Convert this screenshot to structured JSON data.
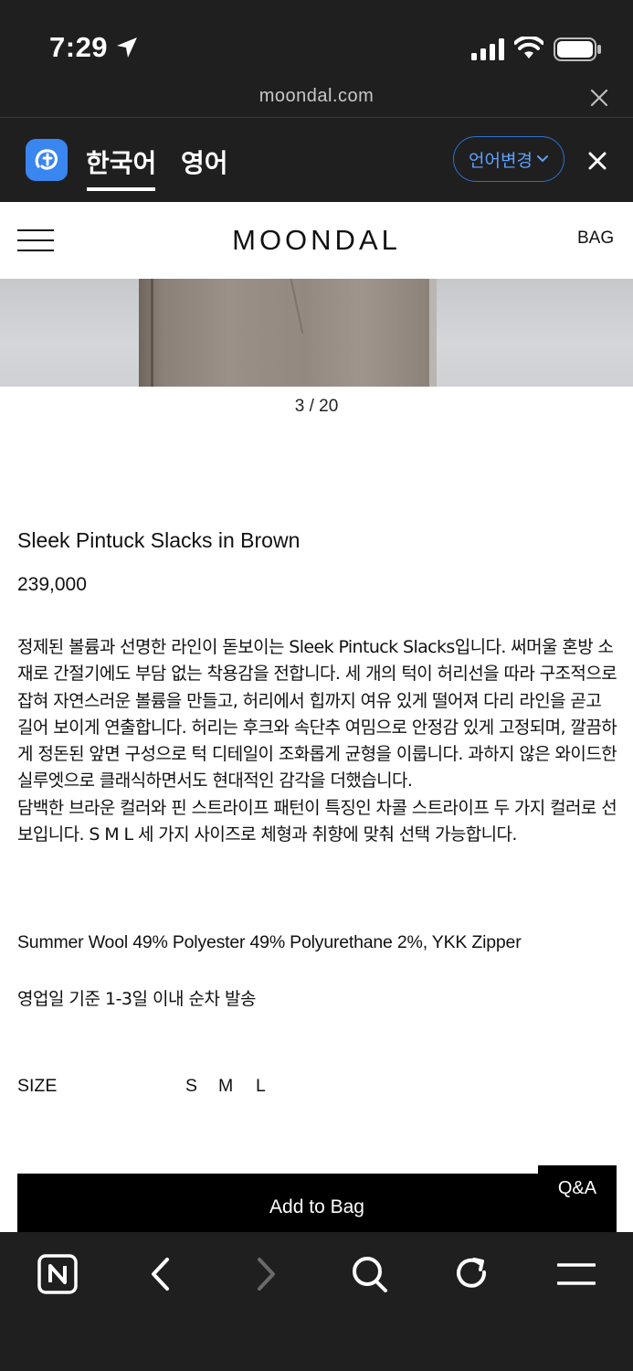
{
  "status_bar": {
    "time": "7:29",
    "icons": [
      "location-arrow-icon",
      "signal-icon",
      "wifi-icon",
      "battery-icon"
    ]
  },
  "browser": {
    "url": "moondal.com",
    "close_icon": "close-icon"
  },
  "translate_bar": {
    "source_language": "한국어",
    "target_language": "영어",
    "change_language_label": "언어변경",
    "accent_color": "#3a86f0"
  },
  "site_header": {
    "brand": "MOONDAL",
    "bag_label": "BAG",
    "menu_icon": "hamburger-menu-icon"
  },
  "gallery": {
    "counter": "3 / 20"
  },
  "product": {
    "title": "Sleek Pintuck Slacks in Brown",
    "price": "239,000",
    "description": [
      "정제된 볼륨과 선명한 라인이 돋보이는 Sleek Pintuck Slacks입니다. 써머울 혼방 소재로 간절기에도 부담 없는 착용감을 전합니다. 세 개의 턱이 허리선을 따라 구조적으로 잡혀 자연스러운 볼륨을 만들고, 허리에서 힙까지 여유 있게 떨어져 다리 라인을 곧고 길어 보이게 연출합니다. 허리는 후크와 속단추 여밈으로 안정감 있게 고정되며, 깔끔하게 정돈된 앞면 구성으로 턱 디테일이 조화롭게 균형을 이룹니다. 과하지 않은 와이드한 실루엣으로 클래식하면서도 현대적인 감각을 더했습니다.",
      "담백한 브라운 컬러와 핀 스트라이프 패턴이 특징인 차콜 스트라이프 두 가지 컬러로 선보입니다. S M L 세 가지 사이즈로 체형과 취향에 맞춰 선택 가능합니다."
    ],
    "material": "Summer Wool 49% Polyester 49% Polyurethane 2%, YKK Zipper",
    "shipping": "영업일 기준 1-3일 이내 순차 발송",
    "size_label": "SIZE",
    "sizes": [
      "S",
      "M",
      "L"
    ]
  },
  "actions": {
    "add_to_bag": "Add to Bag",
    "qa": "Q&A"
  },
  "toolbar": {
    "icons": [
      "naver-logo-icon",
      "back-arrow-icon",
      "forward-arrow-icon",
      "search-icon",
      "refresh-icon",
      "menu-icon"
    ]
  }
}
